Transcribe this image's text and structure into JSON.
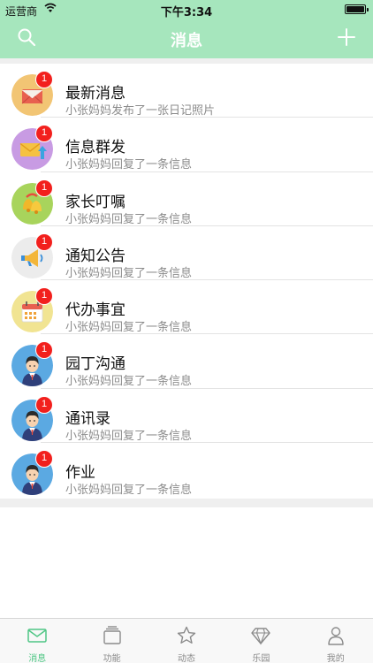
{
  "status_bar": {
    "carrier": "运营商",
    "time": "下午3:34"
  },
  "nav": {
    "title": "消息",
    "left_icon": "search-icon",
    "right_icon": "plus-icon"
  },
  "colors": {
    "nav_background": "#a6e6bd",
    "badge": "#f2201d",
    "tab_active": "#4fc685",
    "tab_inactive": "#8a8a8a"
  },
  "messages": [
    {
      "title": "最新消息",
      "subtitle": "小张妈妈发布了一张日记照片",
      "badge": "1",
      "icon": "envelope-open-icon",
      "icon_bg": "#f2c574"
    },
    {
      "title": "信息群发",
      "subtitle": "小张妈妈回复了一条信息",
      "badge": "1",
      "icon": "envelope-send-icon",
      "icon_bg": "#c89be3"
    },
    {
      "title": "家长叮嘱",
      "subtitle": "小张妈妈回复了一条信息",
      "badge": "1",
      "icon": "bell-icon",
      "icon_bg": "#a8d45c"
    },
    {
      "title": "通知公告",
      "subtitle": "小张妈妈回复了一条信息",
      "badge": "1",
      "icon": "megaphone-icon",
      "icon_bg": "#ececec"
    },
    {
      "title": "代办事宜",
      "subtitle": "小张妈妈回复了一条信息",
      "badge": "1",
      "icon": "calendar-icon",
      "icon_bg": "#f1e492"
    },
    {
      "title": "园丁沟通",
      "subtitle": "小张妈妈回复了一条信息",
      "badge": "1",
      "icon": "teacher-avatar-icon",
      "icon_bg": "#5ba9e2"
    },
    {
      "title": "通讯录",
      "subtitle": "小张妈妈回复了一条信息",
      "badge": "1",
      "icon": "contact-avatar-icon",
      "icon_bg": "#5ba9e2"
    },
    {
      "title": "作业",
      "subtitle": "小张妈妈回复了一条信息",
      "badge": "1",
      "icon": "homework-avatar-icon",
      "icon_bg": "#5ba9e2"
    }
  ],
  "tabs": [
    {
      "label": "消息",
      "icon": "message-icon",
      "active": true
    },
    {
      "label": "功能",
      "icon": "function-icon",
      "active": false
    },
    {
      "label": "动态",
      "icon": "star-icon",
      "active": false
    },
    {
      "label": "乐园",
      "icon": "diamond-icon",
      "active": false
    },
    {
      "label": "我的",
      "icon": "person-icon",
      "active": false
    }
  ]
}
